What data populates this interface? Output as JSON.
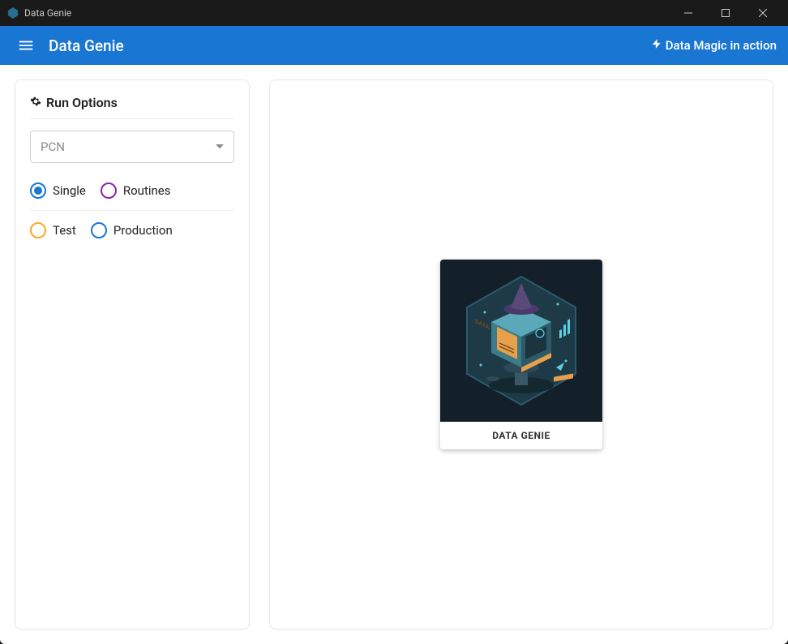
{
  "window": {
    "title": "Data Genie"
  },
  "topbar": {
    "app_title": "Data Genie",
    "tagline": "Data Magic in action"
  },
  "sidebar": {
    "section_title": "Run Options",
    "select": {
      "value": "PCN"
    },
    "radios_mode": [
      {
        "label": "Single",
        "color": "#1976d2",
        "selected": true
      },
      {
        "label": "Routines",
        "color": "#8e24aa",
        "selected": false
      }
    ],
    "radios_env": [
      {
        "label": "Test",
        "color": "#f9a825",
        "selected": false
      },
      {
        "label": "Production",
        "color": "#1976d2",
        "selected": false
      }
    ]
  },
  "main": {
    "card_caption": "DATA GENIE",
    "card_alt": "Isometric data cube with wizard hat and charts"
  },
  "colors": {
    "accent": "#1976d2",
    "titlebar": "#1a1a1a"
  }
}
